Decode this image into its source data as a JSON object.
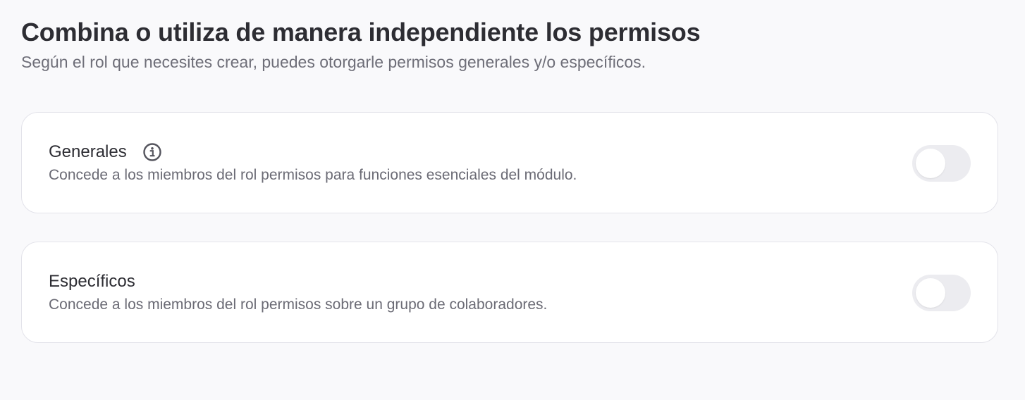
{
  "header": {
    "title": "Combina o utiliza de manera independiente los permisos",
    "subtitle": "Según el rol que necesites crear, puedes otorgarle permisos generales y/o específicos."
  },
  "permissions": [
    {
      "title": "Generales",
      "description": "Concede a los miembros del rol permisos para funciones esenciales del módulo.",
      "has_info_icon": true,
      "info_icon": "info-circle-icon",
      "enabled": false
    },
    {
      "title": "Específicos",
      "description": "Concede a los miembros del rol permisos sobre un grupo de colaboradores.",
      "has_info_icon": false,
      "enabled": false
    }
  ],
  "colors": {
    "background": "#f9f9fb",
    "card": "#ffffff",
    "toggle_off": "#ececf0",
    "title_text": "#2d2d33",
    "muted_text": "#6e6e78"
  }
}
